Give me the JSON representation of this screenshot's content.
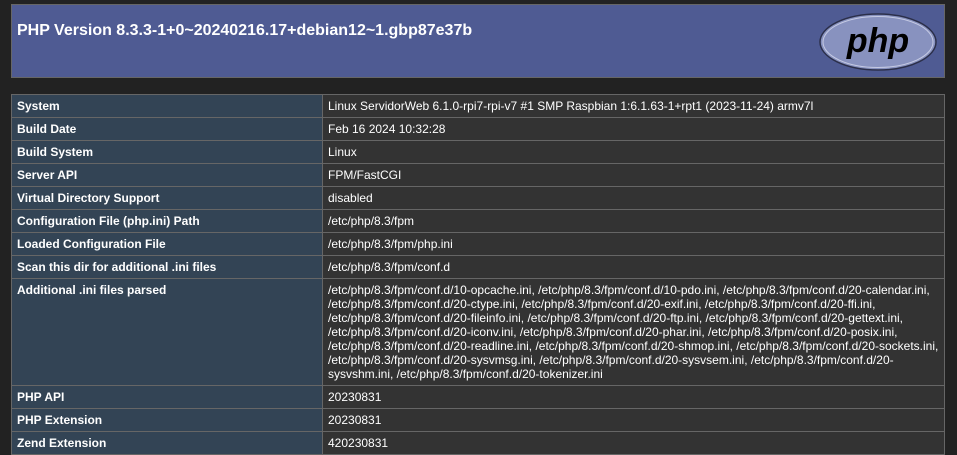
{
  "header": {
    "title": "PHP Version 8.3.3-1+0~20240216.17+debian12~1.gbp87e37b",
    "logo_text": "php"
  },
  "colors": {
    "header_bg": "#4f5b93",
    "label_cell_bg": "#334455",
    "value_cell_bg": "#333333",
    "page_bg": "#222222",
    "border": "#666666"
  },
  "rows": [
    {
      "label": "System",
      "value": "Linux ServidorWeb 6.1.0-rpi7-rpi-v7 #1 SMP Raspbian 1:6.1.63-1+rpt1 (2023-11-24) armv7l"
    },
    {
      "label": "Build Date",
      "value": "Feb 16 2024 10:32:28"
    },
    {
      "label": "Build System",
      "value": "Linux"
    },
    {
      "label": "Server API",
      "value": "FPM/FastCGI"
    },
    {
      "label": "Virtual Directory Support",
      "value": "disabled"
    },
    {
      "label": "Configuration File (php.ini) Path",
      "value": "/etc/php/8.3/fpm"
    },
    {
      "label": "Loaded Configuration File",
      "value": "/etc/php/8.3/fpm/php.ini"
    },
    {
      "label": "Scan this dir for additional .ini files",
      "value": "/etc/php/8.3/fpm/conf.d"
    },
    {
      "label": "Additional .ini files parsed",
      "value": "/etc/php/8.3/fpm/conf.d/10-opcache.ini, /etc/php/8.3/fpm/conf.d/10-pdo.ini, /etc/php/8.3/fpm/conf.d/20-calendar.ini, /etc/php/8.3/fpm/conf.d/20-ctype.ini, /etc/php/8.3/fpm/conf.d/20-exif.ini, /etc/php/8.3/fpm/conf.d/20-ffi.ini, /etc/php/8.3/fpm/conf.d/20-fileinfo.ini, /etc/php/8.3/fpm/conf.d/20-ftp.ini, /etc/php/8.3/fpm/conf.d/20-gettext.ini, /etc/php/8.3/fpm/conf.d/20-iconv.ini, /etc/php/8.3/fpm/conf.d/20-phar.ini, /etc/php/8.3/fpm/conf.d/20-posix.ini, /etc/php/8.3/fpm/conf.d/20-readline.ini, /etc/php/8.3/fpm/conf.d/20-shmop.ini, /etc/php/8.3/fpm/conf.d/20-sockets.ini, /etc/php/8.3/fpm/conf.d/20-sysvmsg.ini, /etc/php/8.3/fpm/conf.d/20-sysvsem.ini, /etc/php/8.3/fpm/conf.d/20-sysvshm.ini, /etc/php/8.3/fpm/conf.d/20-tokenizer.ini"
    },
    {
      "label": "PHP API",
      "value": "20230831"
    },
    {
      "label": "PHP Extension",
      "value": "20230831"
    },
    {
      "label": "Zend Extension",
      "value": "420230831"
    }
  ]
}
